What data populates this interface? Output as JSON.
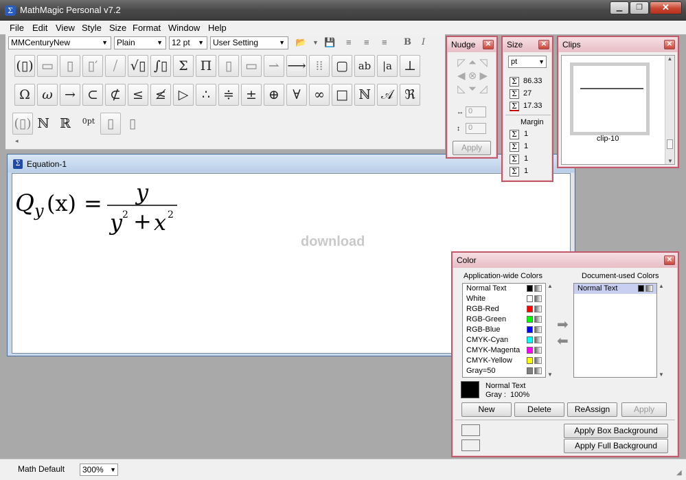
{
  "app": {
    "title": "MathMagic Personal v7.2"
  },
  "menu": [
    "File",
    "Edit",
    "View",
    "Style",
    "Size",
    "Format",
    "Window",
    "Help"
  ],
  "toolbar": {
    "font": "MMCenturyNew",
    "style": "Plain",
    "size": "12 pt",
    "setting": "User Setting",
    "row2": [
      "Ω",
      "ω",
      "→",
      "⊂",
      "⊄",
      "≤",
      "≰",
      "▷",
      "∴",
      "≑",
      "±",
      "⊕",
      "∀",
      "∞",
      "□",
      "ℕ",
      "𝒜",
      "ℜ"
    ],
    "row3_label": "0pt"
  },
  "equation_window": {
    "title": "Equation-1",
    "lhs": "Q",
    "lhs_sub": "y",
    "lhs_arg": "(x)",
    "eq_sign": "=",
    "numerator": "y",
    "denominator_a": "y",
    "denominator_plus": "+",
    "denominator_b": "x",
    "exponent": "2",
    "watermark": "download"
  },
  "nudge": {
    "title": "Nudge",
    "x_value": "0",
    "y_value": "0",
    "apply": "Apply"
  },
  "size_palette": {
    "title": "Size",
    "unit": "pt",
    "width": "86.33",
    "height": "27",
    "depth": "17.33",
    "margin_label": "Margin",
    "margins": [
      "1",
      "1",
      "1",
      "1"
    ]
  },
  "clips": {
    "title": "Clips",
    "item_label": "clip-10"
  },
  "color": {
    "title": "Color",
    "app_header": "Application-wide Colors",
    "doc_header": "Document-used Colors",
    "app_colors": [
      {
        "name": "Normal Text",
        "swatch": "#000000"
      },
      {
        "name": "White",
        "swatch": "#ffffff"
      },
      {
        "name": "RGB-Red",
        "swatch": "#ff0000"
      },
      {
        "name": "RGB-Green",
        "swatch": "#00ff00"
      },
      {
        "name": "RGB-Blue",
        "swatch": "#0000ff"
      },
      {
        "name": "CMYK-Cyan",
        "swatch": "#00ffff"
      },
      {
        "name": "CMYK-Magenta",
        "swatch": "#ff00ff"
      },
      {
        "name": "CMYK-Yellow",
        "swatch": "#ffff00"
      },
      {
        "name": "Gray=50",
        "swatch": "#808080"
      }
    ],
    "doc_colors": [
      {
        "name": "Normal Text",
        "swatch": "#000000"
      }
    ],
    "current_name": "Normal Text",
    "current_value": "Gray :  100%",
    "new": "New",
    "delete": "Delete",
    "reassign": "ReAssign",
    "apply": "Apply",
    "apply_box_bg": "Apply Box Background",
    "apply_full_bg": "Apply Full Background"
  },
  "status": {
    "mode": "Math Default",
    "zoom": "300%"
  }
}
